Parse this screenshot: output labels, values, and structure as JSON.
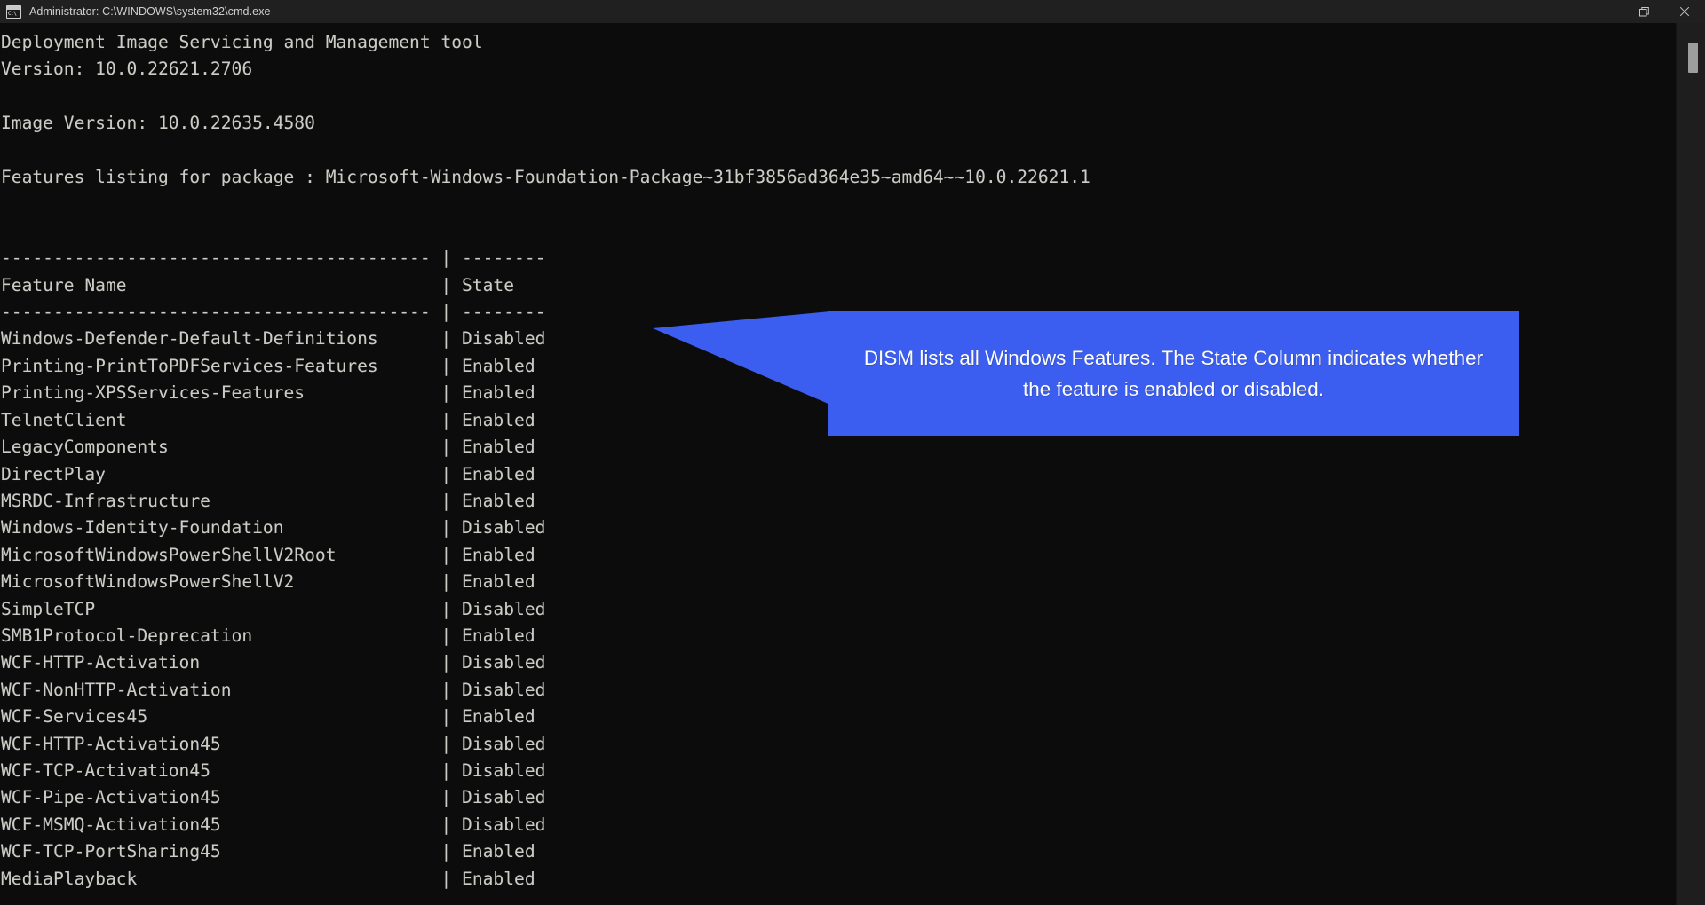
{
  "window": {
    "title": "Administrator: C:\\WINDOWS\\system32\\cmd.exe",
    "icon_glyph": "C:\\",
    "controls": {
      "minimize_label": "Minimize",
      "maximize_label": "Restore Down",
      "close_label": "Close"
    },
    "colors": {
      "titlebar_bg": "#202020",
      "titlebar_text": "#cfcfcf",
      "console_bg": "#0c0c0c",
      "console_text": "#ccccc7",
      "callout_bg": "#3b5ef0",
      "callout_text": "#ffffff",
      "scrollbar_track": "#1e1e1e",
      "scrollbar_thumb": "#9d9d9d"
    }
  },
  "console": {
    "header_lines": [
      "Deployment Image Servicing and Management tool",
      "Version: 10.0.22621.2706",
      "",
      "Image Version: 10.0.22635.4580",
      "",
      "Features listing for package : Microsoft-Windows-Foundation-Package~31bf3856ad364e35~amd64~~10.0.22621.1",
      "",
      ""
    ],
    "table": {
      "rule": "----------------------------------------- | --------",
      "columns": [
        "Feature Name",
        "State"
      ],
      "header_row": "Feature Name                              | State",
      "rows": [
        {
          "feature": "Windows-Defender-Default-Definitions",
          "state": "Disabled"
        },
        {
          "feature": "Printing-PrintToPDFServices-Features",
          "state": "Enabled"
        },
        {
          "feature": "Printing-XPSServices-Features",
          "state": "Enabled"
        },
        {
          "feature": "TelnetClient",
          "state": "Enabled"
        },
        {
          "feature": "LegacyComponents",
          "state": "Enabled"
        },
        {
          "feature": "DirectPlay",
          "state": "Enabled"
        },
        {
          "feature": "MSRDC-Infrastructure",
          "state": "Enabled"
        },
        {
          "feature": "Windows-Identity-Foundation",
          "state": "Disabled"
        },
        {
          "feature": "MicrosoftWindowsPowerShellV2Root",
          "state": "Enabled"
        },
        {
          "feature": "MicrosoftWindowsPowerShellV2",
          "state": "Enabled"
        },
        {
          "feature": "SimpleTCP",
          "state": "Disabled"
        },
        {
          "feature": "SMB1Protocol-Deprecation",
          "state": "Enabled"
        },
        {
          "feature": "WCF-HTTP-Activation",
          "state": "Disabled"
        },
        {
          "feature": "WCF-NonHTTP-Activation",
          "state": "Disabled"
        },
        {
          "feature": "WCF-Services45",
          "state": "Enabled"
        },
        {
          "feature": "WCF-HTTP-Activation45",
          "state": "Disabled"
        },
        {
          "feature": "WCF-TCP-Activation45",
          "state": "Disabled"
        },
        {
          "feature": "WCF-Pipe-Activation45",
          "state": "Disabled"
        },
        {
          "feature": "WCF-MSMQ-Activation45",
          "state": "Disabled"
        },
        {
          "feature": "WCF-TCP-PortSharing45",
          "state": "Enabled"
        },
        {
          "feature": "MediaPlayback",
          "state": "Enabled"
        }
      ]
    },
    "full_text": "Deployment Image Servicing and Management tool\nVersion: 10.0.22621.2706\n\nImage Version: 10.0.22635.4580\n\nFeatures listing for package : Microsoft-Windows-Foundation-Package~31bf3856ad364e35~amd64~~10.0.22621.1\n\n\n----------------------------------------- | --------\nFeature Name                              | State\n----------------------------------------- | --------\nWindows-Defender-Default-Definitions      | Disabled\nPrinting-PrintToPDFServices-Features      | Enabled\nPrinting-XPSServices-Features             | Enabled\nTelnetClient                              | Enabled\nLegacyComponents                          | Enabled\nDirectPlay                                | Enabled\nMSRDC-Infrastructure                      | Enabled\nWindows-Identity-Foundation               | Disabled\nMicrosoftWindowsPowerShellV2Root          | Enabled\nMicrosoftWindowsPowerShellV2              | Enabled\nSimpleTCP                                 | Disabled\nSMB1Protocol-Deprecation                  | Enabled\nWCF-HTTP-Activation                       | Disabled\nWCF-NonHTTP-Activation                    | Disabled\nWCF-Services45                            | Enabled\nWCF-HTTP-Activation45                     | Disabled\nWCF-TCP-Activation45                      | Disabled\nWCF-Pipe-Activation45                     | Disabled\nWCF-MSMQ-Activation45                     | Disabled\nWCF-TCP-PortSharing45                     | Enabled\nMediaPlayback                             | Enabled"
  },
  "annotation": {
    "text": "DISM lists all Windows Features. The State Column indicates whether the feature is enabled or disabled.",
    "points_to": "State"
  }
}
